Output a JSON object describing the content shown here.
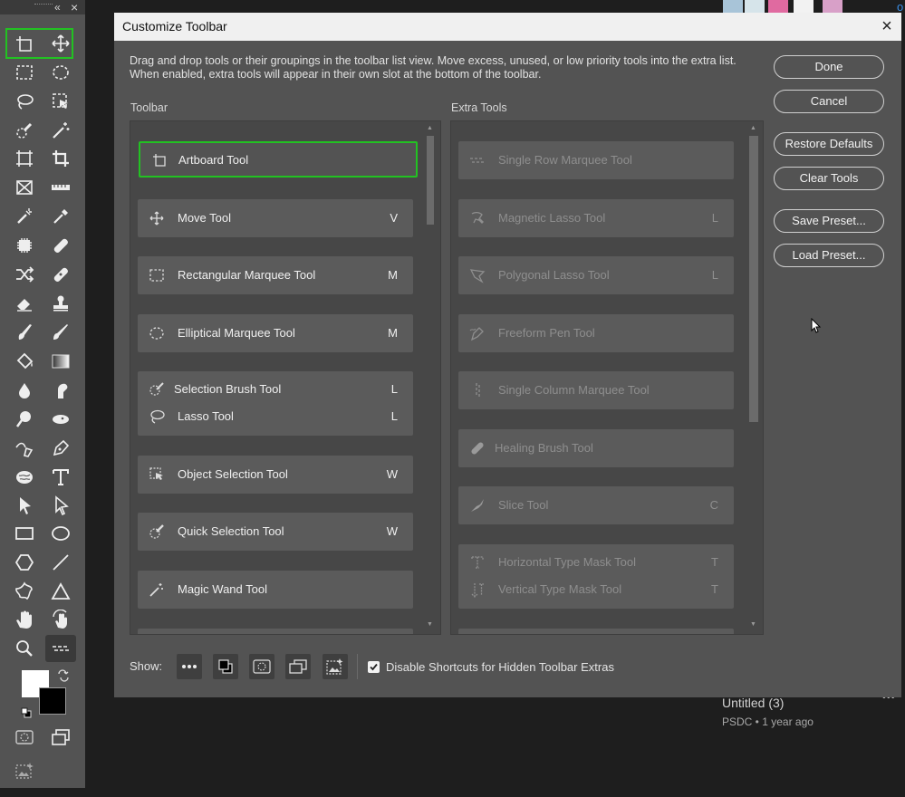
{
  "toolbar_panel": {
    "collapse_glyph": "«",
    "close_glyph": "×",
    "tools": [
      "artboard-icon",
      "move-icon",
      "rect-marquee-icon",
      "ellipse-marquee-icon",
      "lasso-icon",
      "object-selection-icon",
      "quick-selection-icon",
      "magic-wand-icon",
      "frame-crop-icon",
      "crop-icon",
      "frame-icon",
      "ruler-icon",
      "color-sampler-icon",
      "eyedropper-icon",
      "patch-icon",
      "healing-icon",
      "content-aware-move-icon",
      "bandage-icon",
      "eraser-icon",
      "stamp-icon",
      "mixer-brush-icon",
      "brush-icon",
      "paint-bucket-icon",
      "gradient-icon",
      "blur-icon",
      "smudge-icon",
      "dodge-icon",
      "sponge-icon",
      "curvature-pen-icon",
      "pen-icon",
      "brain-icon",
      "type-icon",
      "path-select-icon",
      "direct-select-icon",
      "rectangle-icon",
      "ellipse-icon",
      "polygon-icon",
      "line-icon",
      "custom-shape-icon",
      "triangle-icon",
      "hand-icon",
      "rotate-view-icon",
      "zoom-icon",
      "single-row-icon"
    ]
  },
  "dialog": {
    "title": "Customize Toolbar",
    "description": "Drag and drop tools or their groupings in the toolbar list view. Move excess, unused, or low priority tools into the extra list. When enabled, extra tools will appear in their own slot at the bottom of the toolbar.",
    "toolbar_label": "Toolbar",
    "extra_label": "Extra Tools",
    "buttons": {
      "done": "Done",
      "cancel": "Cancel",
      "restore": "Restore Defaults",
      "clear": "Clear Tools",
      "save": "Save Preset...",
      "load": "Load Preset..."
    },
    "toolbar_items": [
      {
        "label": "Artboard Tool",
        "key": ""
      },
      {
        "label": "Move Tool",
        "key": "V"
      },
      {
        "label": "Rectangular Marquee Tool",
        "key": "M"
      },
      {
        "label": "Elliptical Marquee Tool",
        "key": "M"
      },
      {
        "label": "Selection Brush Tool",
        "key": "L",
        "label2": "Lasso Tool",
        "key2": "L"
      },
      {
        "label": "Object Selection Tool",
        "key": "W"
      },
      {
        "label": "Quick Selection Tool",
        "key": "W"
      },
      {
        "label": "Magic Wand Tool",
        "key": ""
      }
    ],
    "extra_items": [
      {
        "label": "Single Row Marquee Tool",
        "key": ""
      },
      {
        "label": "Magnetic Lasso Tool",
        "key": "L"
      },
      {
        "label": "Polygonal Lasso Tool",
        "key": "L"
      },
      {
        "label": "Freeform Pen Tool",
        "key": ""
      },
      {
        "label": "Single Column Marquee Tool",
        "key": ""
      },
      {
        "label": "Healing Brush Tool",
        "key": ""
      },
      {
        "label": "Slice Tool",
        "key": "C"
      },
      {
        "label": "Horizontal Type Mask Tool",
        "key": "T",
        "label2": "Vertical Type Mask Tool",
        "key2": "T"
      }
    ],
    "show_label": "Show:",
    "disable_shortcuts_label": "Disable Shortcuts for Hidden Toolbar Extras",
    "disable_shortcuts_checked": true
  },
  "background": {
    "doc_title": "Untitled (3)",
    "doc_meta": "PSDC • 1 year ago",
    "more_glyph": "•••",
    "edge_glyph": "o"
  },
  "colors": {
    "selection_green": "#22c222",
    "panel_gray": "#535353",
    "dark_bg": "#1e1e1e"
  }
}
